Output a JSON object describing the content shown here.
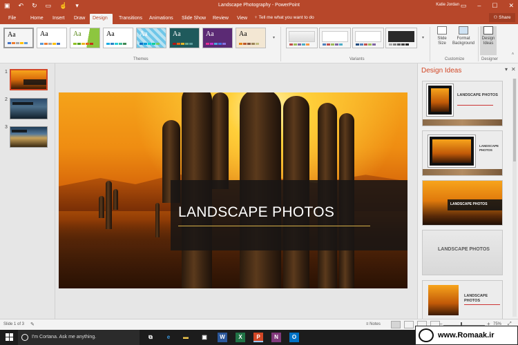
{
  "window": {
    "title": "Landscape Photography - PowerPoint",
    "user": "Katie Jordan"
  },
  "tabs": [
    {
      "label": "File"
    },
    {
      "label": "Home"
    },
    {
      "label": "Insert"
    },
    {
      "label": "Draw"
    },
    {
      "label": "Design",
      "active": true
    },
    {
      "label": "Transitions"
    },
    {
      "label": "Animations"
    },
    {
      "label": "Slide Show"
    },
    {
      "label": "Review"
    },
    {
      "label": "View"
    }
  ],
  "tell_me": "Tell me what you want to do",
  "share_label": "Share",
  "ribbon": {
    "themes_label": "Themes",
    "variants_label": "Variants",
    "customize_label": "Customize",
    "designer_label": "Designer",
    "theme_sample_text": "Aa",
    "slide_size": "Slide Size",
    "format_background": "Format Background",
    "design_ideas": "Design Ideas"
  },
  "thumbnails": [
    {
      "number": "1",
      "selected": true
    },
    {
      "number": "2"
    },
    {
      "number": "3"
    }
  ],
  "slide": {
    "title": "LANDSCAPE PHOTOS"
  },
  "design_ideas": {
    "title": "Design Ideas",
    "ideas": [
      {
        "text": "LANDSCAPE PHOTOS"
      },
      {
        "text": "LANDSCAPE PHOTOS"
      },
      {
        "text": "LANDSCAPE PHOTOS"
      },
      {
        "text": "LANDSCAPE PHOTOS"
      },
      {
        "text": "LANDSCAPE PHOTOS"
      }
    ]
  },
  "status": {
    "slide_info": "Slide 1 of 3",
    "notes": "Notes",
    "zoom": "75%"
  },
  "taskbar": {
    "cortana": "I'm Cortana. Ask me anything."
  },
  "watermark": {
    "text": "www.Romaak.ir",
    "logo": "ROMAAK"
  },
  "colors": {
    "accent": "#b7472a",
    "pane_title": "#d24726"
  }
}
